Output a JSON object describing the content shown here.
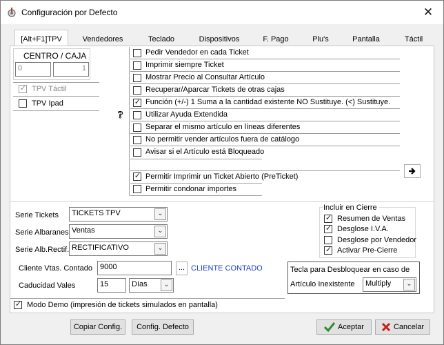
{
  "window": {
    "title": "Configuración por Defecto",
    "close": "✕"
  },
  "tabs": [
    "[Alt+F1]TPV",
    "Vendedores",
    "Teclado",
    "Dispositivos",
    "F. Pago",
    "Plu's",
    "Pantalla",
    "Táctil"
  ],
  "centro": {
    "label": "CENTRO / CAJA",
    "centro_value": "0",
    "caja_value": "1"
  },
  "tpv_tactil": {
    "label": "TPV Táctil",
    "checked": true,
    "disabled": true
  },
  "tpv_ipad": {
    "label": "TPV Ipad",
    "checked": false
  },
  "options": [
    {
      "label": "Pedir Vendedor en cada Ticket",
      "checked": false
    },
    {
      "label": "Imprimir siempre Ticket",
      "checked": false
    },
    {
      "label": "Mostrar Precio al Consultar Artículo",
      "checked": false
    },
    {
      "label": "Recuperar/Aparcar Tickets de otras cajas",
      "checked": false
    },
    {
      "label": "Función (+/-) 1 Suma a la cantidad existente NO Sustituye. (<) Sustituye.",
      "checked": true
    },
    {
      "label": "Utilizar Ayuda Extendida",
      "checked": false
    },
    {
      "label": "Separar el mismo artículo en líneas diferentes",
      "checked": false
    },
    {
      "label": "No permitir vender artículos fuera de catálogo",
      "checked": false
    },
    {
      "label": "Avisar si el Artículo está Bloqueado",
      "checked": false
    }
  ],
  "options2": [
    {
      "label": "Permitir Imprimir un Ticket Abierto (PreTicket)",
      "checked": true
    },
    {
      "label": "Permitir condonar importes",
      "checked": false
    }
  ],
  "series": {
    "tickets_label": "Serie Tickets",
    "tickets_value": "TICKETS TPV",
    "albaranes_label": "Serie Albaranes",
    "albaranes_value": "Ventas",
    "rectif_label": "Serie Alb.Rectif.",
    "rectif_value": "RECTIFICATIVO"
  },
  "cliente": {
    "label": "Cliente Vtas. Contado",
    "value": "9000",
    "browse": "...",
    "name": "CLIENTE CONTADO"
  },
  "caducidad": {
    "label": "Caducidad Vales",
    "value": "15",
    "unit": "Días"
  },
  "cierre": {
    "legend": "Incluir en Cierre",
    "items": [
      {
        "label": "Resumen de Ventas",
        "checked": true
      },
      {
        "label": "Desglose I.V.A.",
        "checked": true
      },
      {
        "label": "Desglose por Vendedor",
        "checked": false
      },
      {
        "label": "Activar Pre-Cierre",
        "checked": true
      }
    ]
  },
  "desbloqueo": {
    "line1": "Tecla para Desbloquear en caso de",
    "line2": "Artículo Inexistente",
    "value": "Multiply"
  },
  "modo_demo": {
    "label": "Modo Demo (impresión de tickets simulados en pantalla)",
    "checked": true
  },
  "buttons": {
    "copiar": "Copiar Config.",
    "defecto": "Config. Defecto",
    "aceptar": "Aceptar",
    "cancelar": "Cancelar"
  },
  "colors": {
    "link": "#1a3fbf",
    "accept_green": "#2e8b2e",
    "cancel_red": "#cc1a1a"
  }
}
